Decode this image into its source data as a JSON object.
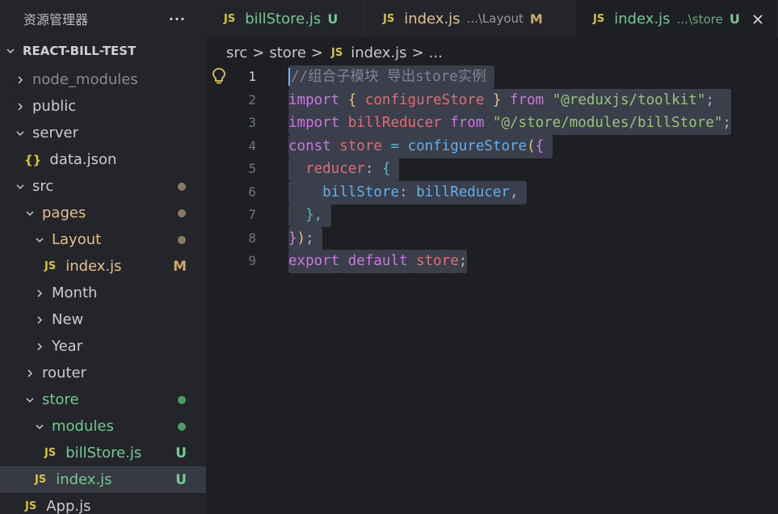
{
  "sidebar": {
    "title": "资源管理器",
    "more": "···",
    "root": "REACT-BILL-TEST",
    "items": [
      {
        "label": "node_modules",
        "status": ""
      },
      {
        "label": "public",
        "status": ""
      },
      {
        "label": "server",
        "status": ""
      },
      {
        "label": "data.json",
        "status": ""
      },
      {
        "label": "src",
        "status": ""
      },
      {
        "label": "pages",
        "status": ""
      },
      {
        "label": "Layout",
        "status": ""
      },
      {
        "label": "index.js",
        "status": "M"
      },
      {
        "label": "Month",
        "status": ""
      },
      {
        "label": "New",
        "status": ""
      },
      {
        "label": "Year",
        "status": ""
      },
      {
        "label": "router",
        "status": ""
      },
      {
        "label": "store",
        "status": ""
      },
      {
        "label": "modules",
        "status": ""
      },
      {
        "label": "billStore.js",
        "status": "U"
      },
      {
        "label": "index.js",
        "status": "U"
      },
      {
        "label": "App.js",
        "status": ""
      }
    ]
  },
  "tabs": [
    {
      "icon": "JS",
      "label": "billStore.js",
      "desc": "",
      "status": "U"
    },
    {
      "icon": "JS",
      "label": "index.js",
      "desc": "...\\Layout",
      "status": "M"
    },
    {
      "icon": "JS",
      "label": "index.js",
      "desc": "...\\store",
      "status": "U"
    }
  ],
  "breadcrumb": {
    "parts": [
      "src",
      "store",
      "index.js",
      "..."
    ],
    "sep": ">",
    "icon": "JS"
  },
  "editor": {
    "line_numbers": [
      "1",
      "2",
      "3",
      "4",
      "5",
      "6",
      "7",
      "8",
      "9"
    ],
    "code": {
      "l1_comment": "//组合子模块 导出store实例",
      "l2_import": "import",
      "l2_open": "{",
      "l2_name": "configureStore",
      "l2_close": "}",
      "l2_from": "from",
      "l2_src": "\"@reduxjs/toolkit\"",
      "l2_semi": ";",
      "l3_import": "import",
      "l3_name": "billReducer",
      "l3_from": "from",
      "l3_src": "\"@/store/modules/billStore\"",
      "l3_semi": ";",
      "l4_const": "const",
      "l4_name": "store",
      "l4_eq": "=",
      "l4_fn": "configureStore",
      "l4_paren": "(",
      "l4_brace": "{",
      "l5_key": "reducer",
      "l5_colon": ":",
      "l5_brace": "{",
      "l6_key": "billStore",
      "l6_colon": ":",
      "l6_val": "billReducer",
      "l6_comma": ",",
      "l7_close": "},",
      "l8_brace": "}",
      "l8_paren": ")",
      "l8_semi": ";",
      "l9_export": "export",
      "l9_default": "default",
      "l9_name": "store",
      "l9_semi": ";"
    }
  },
  "colors": {
    "keyword": "#c678dd",
    "variable": "#e06c75",
    "string": "#98c379",
    "function": "#61afef",
    "untracked": "#73c991",
    "modified": "#c9a86a",
    "js_icon": "#d6c33b"
  }
}
